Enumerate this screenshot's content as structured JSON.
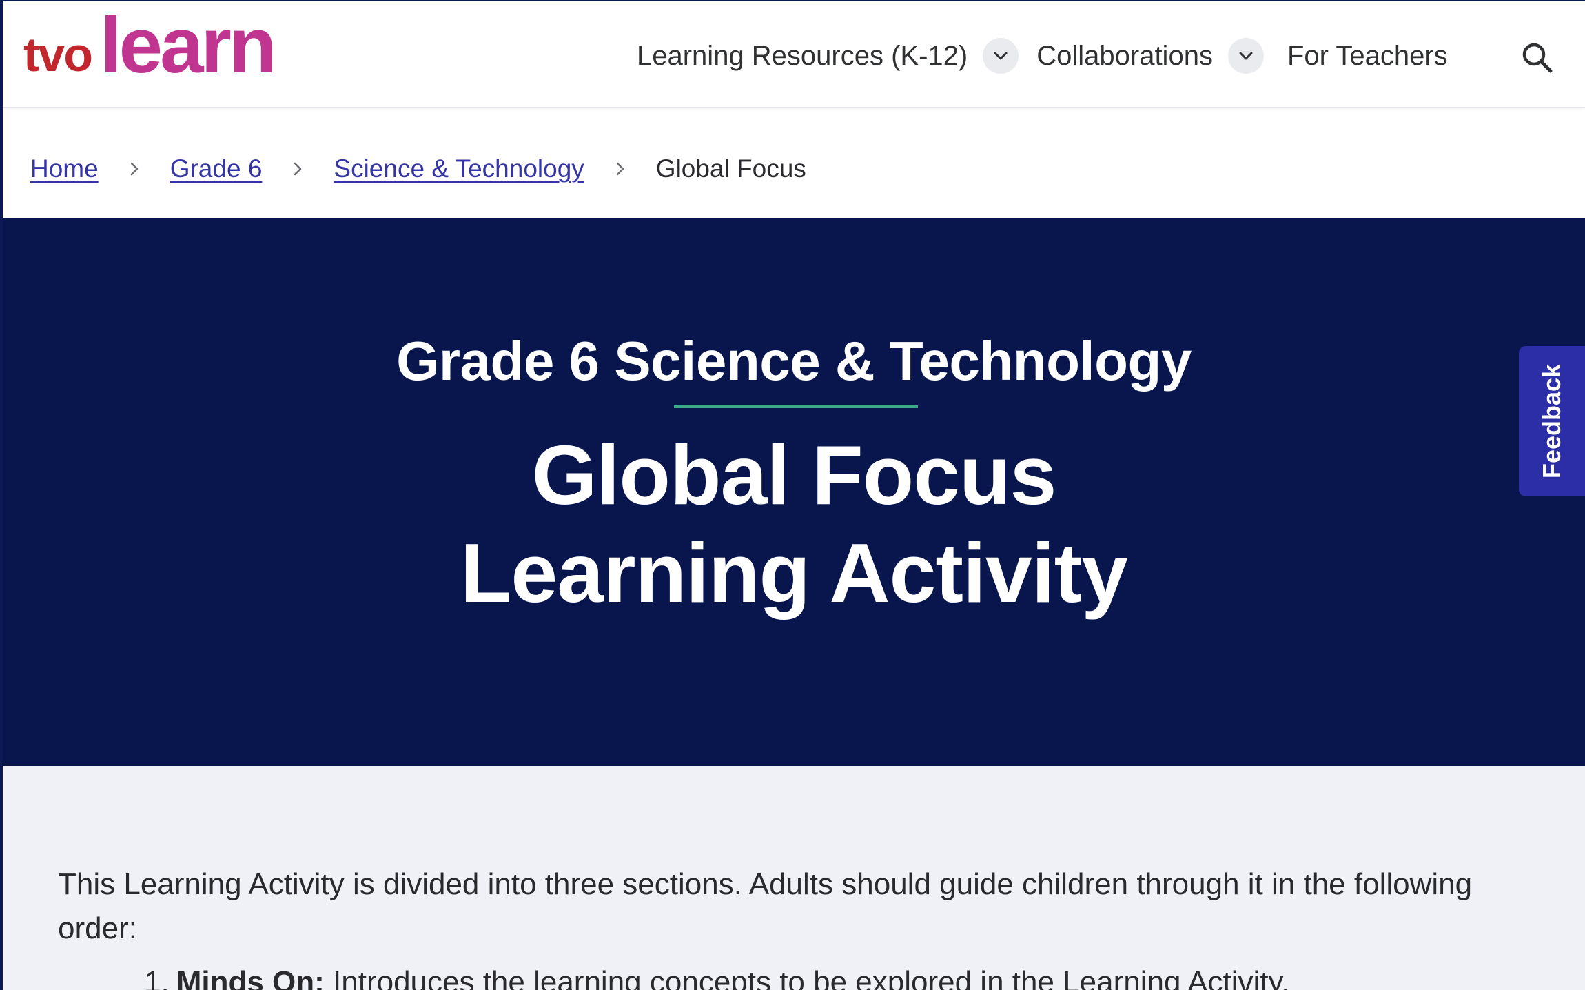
{
  "header": {
    "logo": {
      "part1": "tvo",
      "part2": "learn"
    },
    "nav": [
      {
        "label": "Learning Resources (K-12)",
        "has_dropdown": true
      },
      {
        "label": "Collaborations",
        "has_dropdown": true
      },
      {
        "label": "For Teachers",
        "has_dropdown": false
      }
    ],
    "search_icon": "search-icon"
  },
  "breadcrumb": {
    "items": [
      "Home",
      "Grade 6",
      "Science & Technology"
    ],
    "current": "Global Focus"
  },
  "hero": {
    "kicker": "Grade 6 Science & Technology",
    "title_line1": "Global Focus",
    "title_line2": "Learning Activity"
  },
  "feedback_label": "Feedback",
  "content": {
    "intro": "This Learning Activity is divided into three sections. Adults should guide children through it in the following order:",
    "list": [
      {
        "number": "1.",
        "term": "Minds On:",
        "text": " Introduces the learning concepts to be explored in the Learning Activity."
      }
    ]
  },
  "colors": {
    "logo_tvo": "#c1272d",
    "logo_learn": "#c0358f",
    "hero_bg": "#08164d",
    "hero_rule": "#3ea98a",
    "link": "#3535a8",
    "feedback_bg": "#2c2ea8",
    "content_bg": "#f0f1f6"
  }
}
